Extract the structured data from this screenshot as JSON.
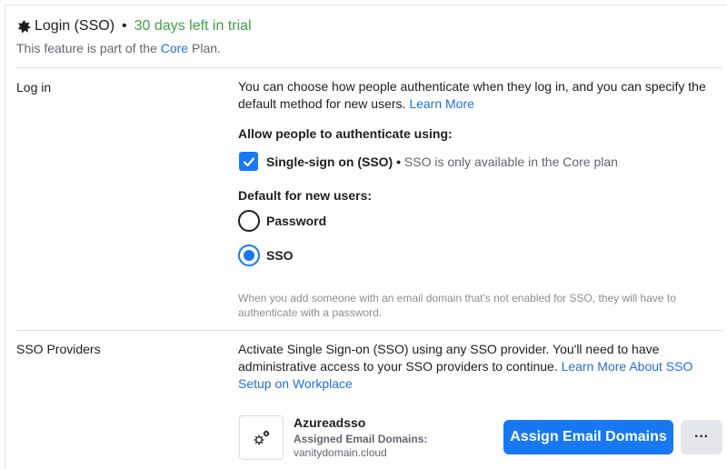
{
  "header": {
    "icon": "star-badge-icon",
    "title": "Login (SSO)",
    "separator": "•",
    "trial": "30 days left in trial",
    "trial_color": "#42a048",
    "subtitle_prefix": "This feature is part of the ",
    "subtitle_link": "Core",
    "subtitle_suffix": " Plan."
  },
  "login": {
    "label": "Log in",
    "description": "You can choose how people authenticate when they log in, and you can specify the default method for new users.",
    "learn_more": "Learn More",
    "allow_heading": "Allow people to authenticate using:",
    "sso_checkbox": {
      "checked": true,
      "label": "Single-sign on (SSO)",
      "separator": " • ",
      "note": "SSO is only available in the Core plan"
    },
    "default_heading": "Default for new users:",
    "options": [
      {
        "label": "Password",
        "selected": false
      },
      {
        "label": "SSO",
        "selected": true
      }
    ],
    "footnote": "When you add someone with an email domain that's not enabled for SSO, they will have to authenticate with a password."
  },
  "providers": {
    "label": "SSO Providers",
    "description": "Activate Single Sign-on (SSO) using any SSO provider. You'll need to have administrative access to your SSO providers to continue.",
    "learn_more": "Learn More About SSO Setup on Workplace",
    "provider": {
      "icon": "gears-icon",
      "name": "Azureadsso",
      "assigned_label": "Assigned Email Domains:",
      "domain": "vanitydomain.cloud"
    },
    "assign_button": "Assign Email Domains",
    "more_button": "···"
  },
  "colors": {
    "accent": "#1877f2",
    "link": "#216fdb",
    "trial": "#42a048"
  }
}
